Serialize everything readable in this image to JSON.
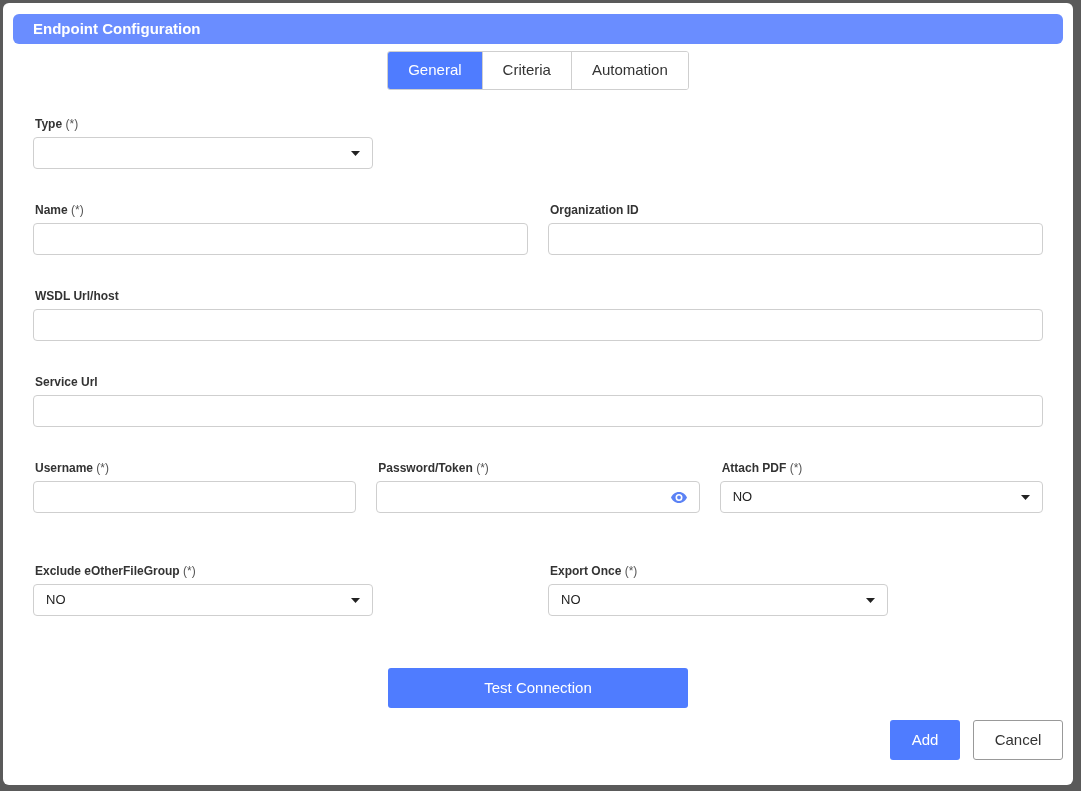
{
  "dialog": {
    "title": "Endpoint Configuration"
  },
  "tabs": [
    {
      "label": "General",
      "selected": true
    },
    {
      "label": "Criteria",
      "selected": false
    },
    {
      "label": "Automation",
      "selected": false
    }
  ],
  "rows": [
    {
      "fields": [
        {
          "kind": "select",
          "label": "Type",
          "mark": "(*)"
        }
      ]
    },
    {
      "fields": [
        {
          "kind": "text",
          "label": "Name",
          "mark": "(*)"
        },
        {
          "kind": "text",
          "label": "Organization ID"
        }
      ]
    },
    {
      "fields": [
        {
          "kind": "text",
          "label": "WSDL Url/host"
        }
      ]
    },
    {
      "fields": [
        {
          "kind": "text",
          "label": "Service Url"
        }
      ]
    },
    {
      "fields": [
        {
          "kind": "text",
          "label": "Username",
          "mark": "(*)"
        },
        {
          "kind": "password",
          "label": "Password/Token",
          "mark": "(*)"
        },
        {
          "kind": "select",
          "label": "Attach PDF",
          "mark": "(*)",
          "value": "NO"
        }
      ]
    },
    {
      "fields": [
        {
          "kind": "select",
          "label": "Exclude eOtherFileGroup",
          "mark": "(*)",
          "value": "NO"
        },
        {
          "kind": "select",
          "label": "Export Once",
          "mark": "(*)",
          "value": "NO"
        }
      ]
    }
  ],
  "test_button": "Test Connection",
  "buttons": [
    {
      "label": "Add",
      "kind": "primary"
    },
    {
      "label": "Cancel",
      "kind": "secondary"
    }
  ]
}
